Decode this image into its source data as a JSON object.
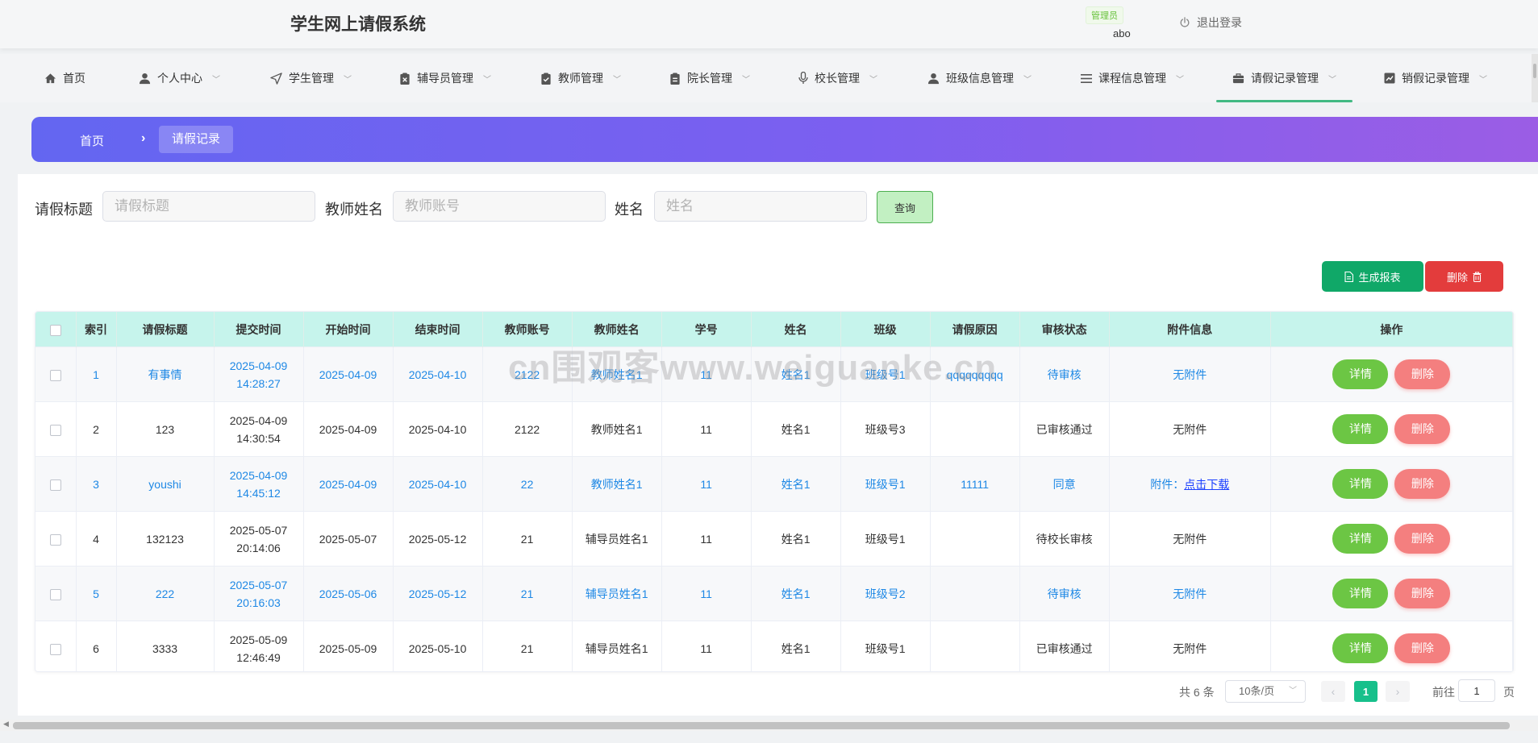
{
  "header": {
    "app_title": "学生网上请假系统",
    "role_badge": "管理员",
    "username": "abo",
    "logout_label": "退出登录"
  },
  "nav": {
    "items": [
      {
        "label": "首页",
        "icon": "home-icon"
      },
      {
        "label": "个人中心",
        "icon": "user-icon"
      },
      {
        "label": "学生管理",
        "icon": "send-icon"
      },
      {
        "label": "辅导员管理",
        "icon": "clipboard-x-icon"
      },
      {
        "label": "教师管理",
        "icon": "clipboard-check-icon"
      },
      {
        "label": "院长管理",
        "icon": "clipboard-icon"
      },
      {
        "label": "校长管理",
        "icon": "microphone-icon"
      },
      {
        "label": "班级信息管理",
        "icon": "user-icon"
      },
      {
        "label": "课程信息管理",
        "icon": "list-icon"
      },
      {
        "label": "请假记录管理",
        "icon": "briefcase-icon"
      },
      {
        "label": "销假记录管理",
        "icon": "chart-icon"
      }
    ],
    "active": "请假记录管理"
  },
  "breadcrumb": {
    "home": "首页",
    "current": "请假记录"
  },
  "search": {
    "title_label": "请假标题",
    "title_placeholder": "请假标题",
    "teacher_label": "教师姓名",
    "teacher_placeholder": "教师账号",
    "name_label": "姓名",
    "name_placeholder": "姓名",
    "query_label": "查询"
  },
  "actions": {
    "report_label": "生成报表",
    "delete_label": "删除"
  },
  "table": {
    "columns": [
      "索引",
      "请假标题",
      "提交时间",
      "开始时间",
      "结束时间",
      "教师账号",
      "教师姓名",
      "学号",
      "姓名",
      "班级",
      "请假原因",
      "审核状态",
      "附件信息",
      "操作"
    ],
    "rows": [
      {
        "index": "1",
        "title": "有事情",
        "submit_date": "2025-04-09",
        "submit_time": "14:28:27",
        "start": "2025-04-09",
        "end": "2025-04-10",
        "teacher_account": "2122",
        "teacher_name": "教师姓名1",
        "student_no": "11",
        "name": "姓名1",
        "class": "班级号1",
        "reason": "qqqqqqqqq",
        "status": "待审核",
        "attachment": "无附件",
        "attachment_link": "",
        "highlight": true
      },
      {
        "index": "2",
        "title": "123",
        "submit_date": "2025-04-09",
        "submit_time": "14:30:54",
        "start": "2025-04-09",
        "end": "2025-04-10",
        "teacher_account": "2122",
        "teacher_name": "教师姓名1",
        "student_no": "11",
        "name": "姓名1",
        "class": "班级号3",
        "reason": "",
        "status": "已审核通过",
        "attachment": "无附件",
        "attachment_link": "",
        "highlight": false
      },
      {
        "index": "3",
        "title": "youshi",
        "submit_date": "2025-04-09",
        "submit_time": "14:45:12",
        "start": "2025-04-09",
        "end": "2025-04-10",
        "teacher_account": "22",
        "teacher_name": "教师姓名1",
        "student_no": "11",
        "name": "姓名1",
        "class": "班级号1",
        "reason": "11111",
        "status": "同意",
        "attachment": "附件：",
        "attachment_link": "点击下载",
        "highlight": true
      },
      {
        "index": "4",
        "title": "132123",
        "submit_date": "2025-05-07",
        "submit_time": "20:14:06",
        "start": "2025-05-07",
        "end": "2025-05-12",
        "teacher_account": "21",
        "teacher_name": "辅导员姓名1",
        "student_no": "11",
        "name": "姓名1",
        "class": "班级号1",
        "reason": "",
        "status": "待校长审核",
        "attachment": "无附件",
        "attachment_link": "",
        "highlight": false
      },
      {
        "index": "5",
        "title": "222",
        "submit_date": "2025-05-07",
        "submit_time": "20:16:03",
        "start": "2025-05-06",
        "end": "2025-05-12",
        "teacher_account": "21",
        "teacher_name": "辅导员姓名1",
        "student_no": "11",
        "name": "姓名1",
        "class": "班级号2",
        "reason": "",
        "status": "待审核",
        "attachment": "无附件",
        "attachment_link": "",
        "highlight": true
      },
      {
        "index": "6",
        "title": "3333",
        "submit_date": "2025-05-09",
        "submit_time": "12:46:49",
        "start": "2025-05-09",
        "end": "2025-05-10",
        "teacher_account": "21",
        "teacher_name": "辅导员姓名1",
        "student_no": "11",
        "name": "姓名1",
        "class": "班级号1",
        "reason": "",
        "status": "已审核通过",
        "attachment": "无附件",
        "attachment_link": "",
        "highlight": false
      }
    ],
    "detail_label": "详情",
    "delete_label": "删除"
  },
  "pagination": {
    "total": "共 6 条",
    "page_size": "10条/页",
    "current_page": "1",
    "goto_label": "前往",
    "goto_value": "1",
    "page_suffix": "页"
  },
  "watermark": "cn围观客www.weiguanke.cn",
  "colors": {
    "accent": "#17c08b",
    "link_blue": "#1e88e5",
    "header_row": "#c6f4ec",
    "detail_button": "#6cc644",
    "delete_button": "#f47f7f"
  }
}
